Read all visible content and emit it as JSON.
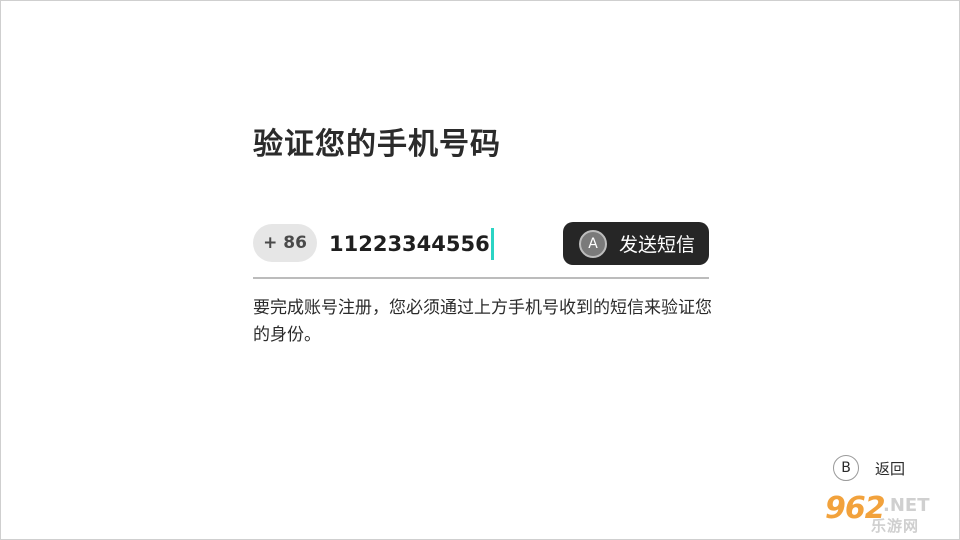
{
  "page": {
    "title": "验证您的手机号码"
  },
  "phone": {
    "country_code": "+ 86",
    "number": "11223344556"
  },
  "send_button": {
    "icon_letter": "A",
    "label": "发送短信"
  },
  "description": "要完成账号注册，您必须通过上方手机号收到的短信来验证您的身份。",
  "back": {
    "icon_letter": "B",
    "label": "返回"
  },
  "watermark": {
    "main": "962",
    "net": ".NET",
    "sub": "乐游网"
  },
  "colors": {
    "caret": "#2bd4c4",
    "button_bg": "#262626",
    "pill_bg": "#e6e6e6",
    "watermark": "#f2a23c"
  }
}
